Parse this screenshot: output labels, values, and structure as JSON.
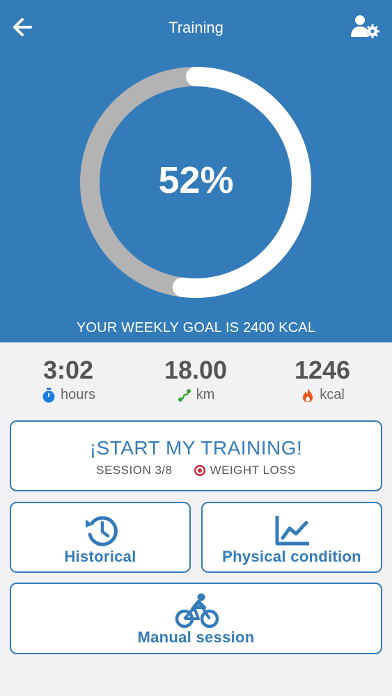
{
  "header": {
    "title": "Training",
    "back_icon": "arrow-left-icon",
    "profile_icon": "user-settings-icon"
  },
  "progress": {
    "percent_label": "52%",
    "percent_value": 52,
    "goal_text": "YOUR WEEKLY GOAL IS 2400 KCAL"
  },
  "stats": [
    {
      "value": "3:02",
      "unit": "hours",
      "icon": "stopwatch-icon",
      "color": "#1e7ee0"
    },
    {
      "value": "18.00",
      "unit": "km",
      "icon": "route-icon",
      "color": "#3aa23a"
    },
    {
      "value": "1246",
      "unit": "kcal",
      "icon": "flame-icon",
      "color": "#f0541c"
    }
  ],
  "start": {
    "title": "¡START MY TRAINING!",
    "session": "SESSION 3/8",
    "goal": "WEIGHT LOSS",
    "goal_icon": "target-icon"
  },
  "actions": {
    "historical": "Historical",
    "physical": "Physical condition",
    "manual": "Manual session"
  },
  "colors": {
    "primary": "#347bb9",
    "ring_track": "#b3b3b3",
    "ring_fill": "#ffffff",
    "background": "#f2f2f4"
  }
}
